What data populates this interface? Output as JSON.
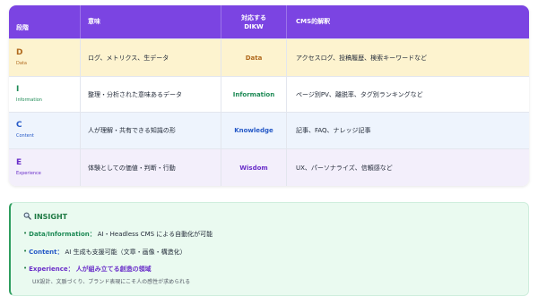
{
  "colors": {
    "header_bg": "#7b44e2",
    "data": "#b0691d",
    "information": "#1d8a55",
    "knowledge": "#2559c7",
    "wisdom": "#6a2fc9",
    "insight_green": "#1f7a44"
  },
  "table": {
    "headers": {
      "stage": "段階",
      "meaning": "意味",
      "dikw_line1": "対応する",
      "dikw_line2": "DIKW",
      "cms": "CMS的解釈"
    },
    "rows": [
      {
        "letter": "D",
        "word": "Data",
        "meaning": "ログ、メトリクス、生データ",
        "dikw": "Data",
        "cms": "アクセスログ、投稿履歴、検索キーワードなど"
      },
      {
        "letter": "I",
        "word": "Information",
        "meaning": "整理・分析された意味あるデータ",
        "dikw": "Information",
        "cms": "ページ別PV、離脱率、タグ別ランキングなど"
      },
      {
        "letter": "C",
        "word": "Content",
        "meaning": "人が理解・共有できる知識の形",
        "dikw": "Knowledge",
        "cms": "記事、FAQ、ナレッジ記事"
      },
      {
        "letter": "E",
        "word": "Experience",
        "meaning": "体験としての価値・判断・行動",
        "dikw": "Wisdom",
        "cms": "UX、パーソナライズ、信頼感など"
      }
    ]
  },
  "insight": {
    "icon": "magnifier-icon",
    "title": "INSIGHT",
    "lines": [
      {
        "bullet": "•",
        "key": "Data/Information：",
        "text": "AI・Headless CMS による自動化が可能"
      },
      {
        "bullet": "•",
        "key": "Content：",
        "text": "AI 生成も支援可能（文章・画像・構造化）"
      },
      {
        "bullet": "•",
        "key": "Experience：",
        "text": "人が組み立てる創造の領域"
      }
    ],
    "sub": "UX設計、文脈づくり、ブランド表現にこそ人の感性が求められる"
  }
}
